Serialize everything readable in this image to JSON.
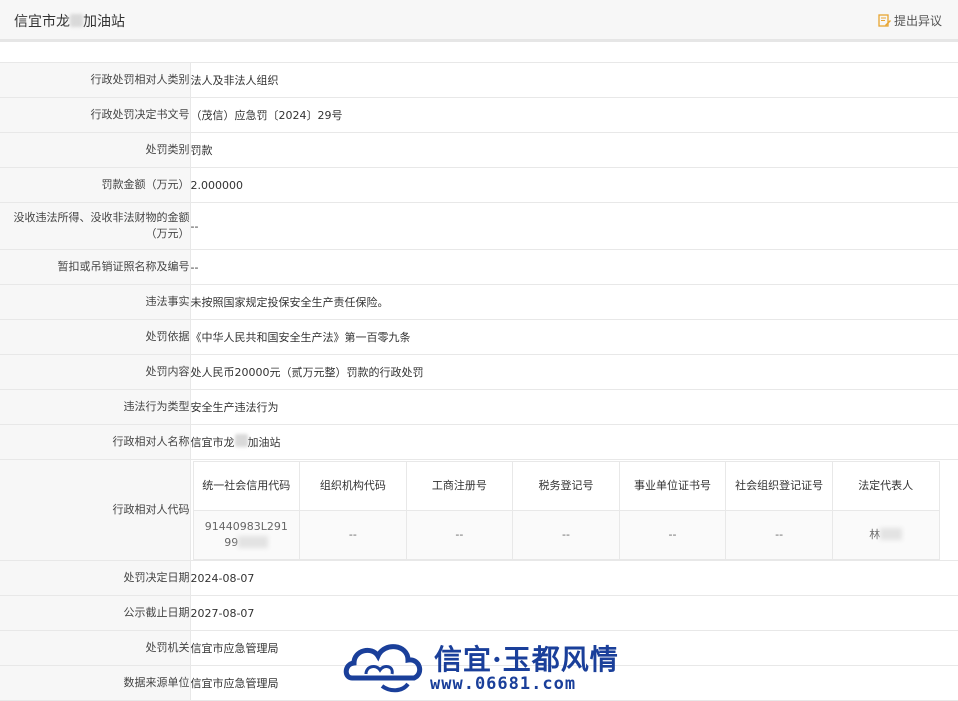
{
  "header": {
    "title_prefix": "信宜市龙",
    "title_suffix": "加油站",
    "objection_label": "提出异议",
    "objection_icon": "edit-document-icon"
  },
  "rows": [
    {
      "label": "行政处罚相对人类别",
      "value": "法人及非法人组织"
    },
    {
      "label": "行政处罚决定书文号",
      "value": "（茂信）应急罚〔2024〕29号"
    },
    {
      "label": "处罚类别",
      "value": "罚款"
    },
    {
      "label": "罚款金额（万元）",
      "value": "2.000000"
    },
    {
      "label": "没收违法所得、没收非法财物的金额（万元）",
      "value": "--"
    },
    {
      "label": "暂扣或吊销证照名称及编号",
      "value": "--"
    },
    {
      "label": "违法事实",
      "value": "未按照国家规定投保安全生产责任保险。"
    },
    {
      "label": "处罚依据",
      "value": "《中华人民共和国安全生产法》第一百零九条"
    },
    {
      "label": "处罚内容",
      "value": "处人民币20000元（贰万元整）罚款的行政处罚"
    },
    {
      "label": "违法行为类型",
      "value": "安全生产违法行为"
    },
    {
      "label": "行政相对人名称",
      "value_prefix": "信宜市龙",
      "value_suffix": "加油站"
    },
    {
      "label": "行政相对人代码"
    },
    {
      "label": "处罚决定日期",
      "value": "2024-08-07"
    },
    {
      "label": "公示截止日期",
      "value": "2027-08-07"
    },
    {
      "label": "处罚机关",
      "value": "信宜市应急管理局"
    },
    {
      "label": "数据来源单位",
      "value": "信宜市应急管理局"
    }
  ],
  "code_table": {
    "headers": [
      "统一社会信用代码",
      "组织机构代码",
      "工商注册号",
      "税务登记号",
      "事业单位证书号",
      "社会组织登记证号",
      "法定代表人"
    ],
    "values": [
      "91440983L291",
      "--",
      "--",
      "--",
      "--",
      "--"
    ],
    "credit_code_line2": "99",
    "legal_rep": "林"
  },
  "watermark": {
    "title": "信宜·玉都风情",
    "url": "www.06681.com",
    "color": "#1a3f9a"
  }
}
